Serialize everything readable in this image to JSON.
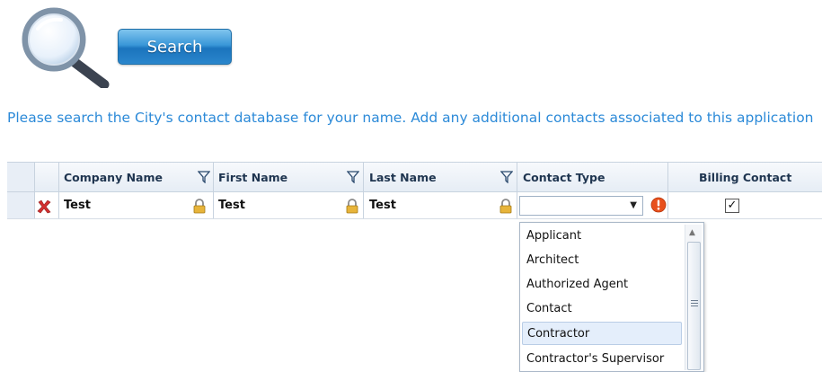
{
  "header": {
    "icon": "magnifier-icon",
    "search_label": "Search"
  },
  "instructions": "Please search the City's contact database for your name.  Add any additional contacts associated to this application",
  "grid": {
    "columns": [
      "Company Name",
      "First Name",
      "Last Name",
      "Contact Type",
      "Billing Contact"
    ],
    "row": {
      "company_name": "Test",
      "first_name": "Test",
      "last_name": "Test",
      "contact_type": "",
      "billing_contact": true
    }
  },
  "dropdown": {
    "options": [
      "Applicant",
      "Architect",
      "Authorized Agent",
      "Contact",
      "Contractor",
      "Contractor's Supervisor"
    ],
    "hovered": "Contractor"
  },
  "colors": {
    "accent": "#2c8ad8",
    "button": "#1b74bd",
    "alert": "#e8501c",
    "delete": "#d32f2f"
  }
}
